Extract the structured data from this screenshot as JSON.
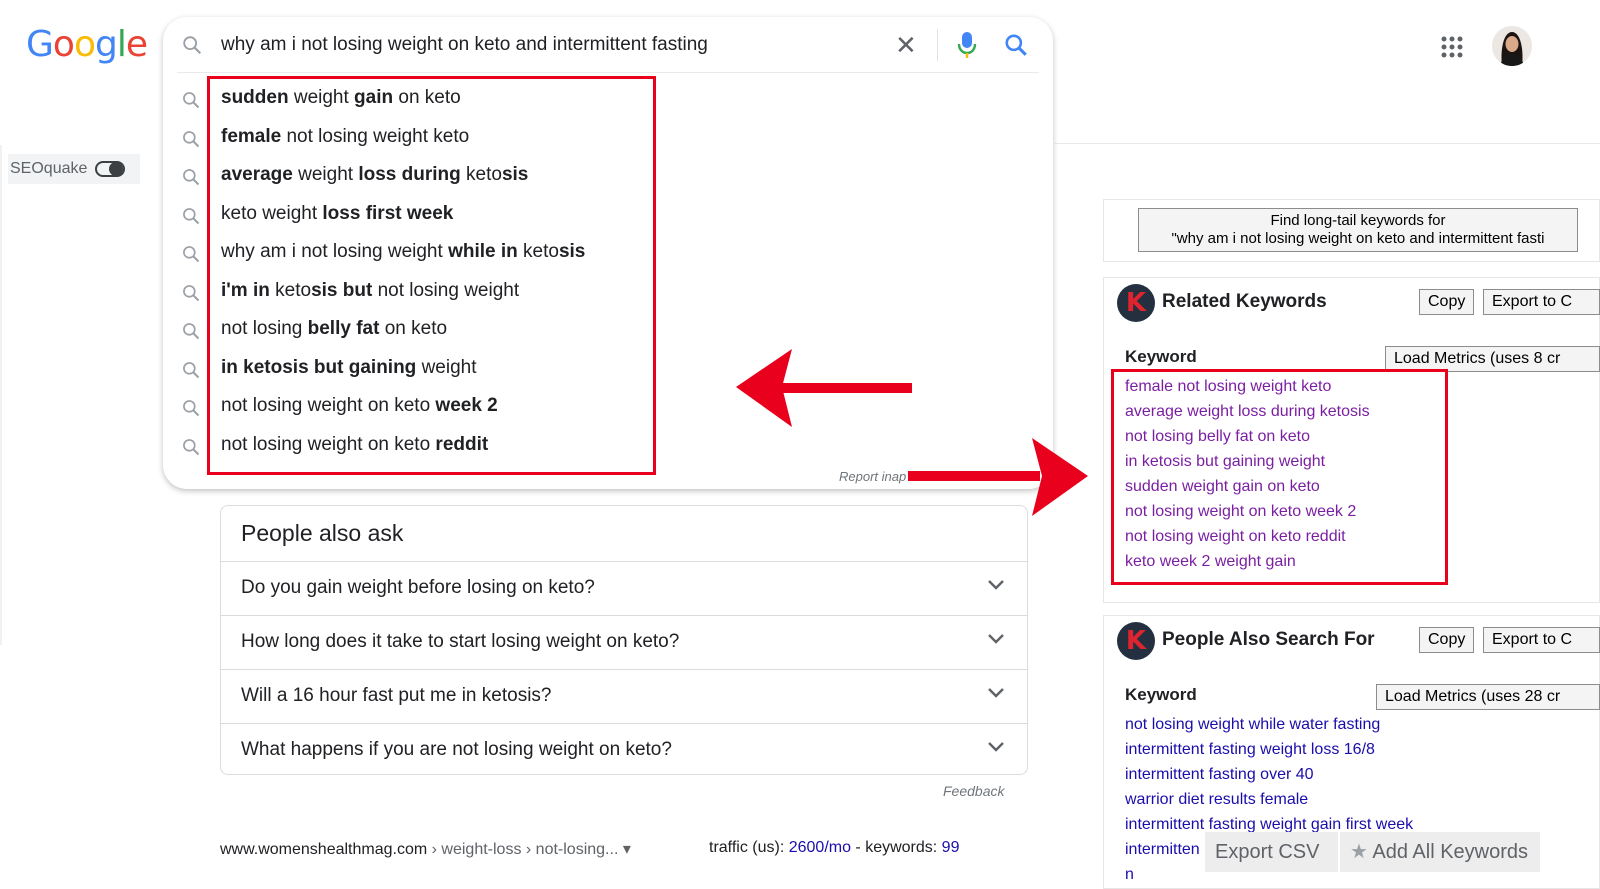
{
  "google": {
    "logo_letters": [
      "G",
      "o",
      "o",
      "g",
      "l",
      "e"
    ],
    "logo_colors": [
      "#4285F4",
      "#EA4335",
      "#FBBC05",
      "#4285F4",
      "#34A853",
      "#EA4335"
    ]
  },
  "search": {
    "query": "why am i not losing weight on keto and intermittent fasting",
    "suggestions": [
      {
        "parts": [
          {
            "t": "sudden",
            "b": true
          },
          {
            "t": " weight ",
            "b": false
          },
          {
            "t": "gain",
            "b": true
          },
          {
            "t": " on keto",
            "b": false
          }
        ]
      },
      {
        "parts": [
          {
            "t": "female",
            "b": true
          },
          {
            "t": " not losing weight keto",
            "b": false
          }
        ]
      },
      {
        "parts": [
          {
            "t": "average",
            "b": true
          },
          {
            "t": " weight ",
            "b": false
          },
          {
            "t": "loss during",
            "b": true
          },
          {
            "t": " keto",
            "b": false
          },
          {
            "t": "sis",
            "b": true
          }
        ]
      },
      {
        "parts": [
          {
            "t": "keto weight ",
            "b": false
          },
          {
            "t": "loss first week",
            "b": true
          }
        ]
      },
      {
        "parts": [
          {
            "t": "why am i not losing weight ",
            "b": false
          },
          {
            "t": "while",
            "b": true
          },
          {
            "t": " ",
            "b": false
          },
          {
            "t": "in",
            "b": true
          },
          {
            "t": " keto",
            "b": false
          },
          {
            "t": "sis",
            "b": true
          }
        ]
      },
      {
        "parts": [
          {
            "t": "i'm in",
            "b": true
          },
          {
            "t": " keto",
            "b": false
          },
          {
            "t": "sis but",
            "b": true
          },
          {
            "t": " not losing weight",
            "b": false
          }
        ]
      },
      {
        "parts": [
          {
            "t": "not losing ",
            "b": false
          },
          {
            "t": "belly fat",
            "b": true
          },
          {
            "t": " on keto",
            "b": false
          }
        ]
      },
      {
        "parts": [
          {
            "t": "in ketosis but gaining",
            "b": true
          },
          {
            "t": " weight",
            "b": false
          }
        ]
      },
      {
        "parts": [
          {
            "t": "not losing weight on keto ",
            "b": false
          },
          {
            "t": "week 2",
            "b": true
          }
        ]
      },
      {
        "parts": [
          {
            "t": "not losing weight on keto ",
            "b": false
          },
          {
            "t": "reddit",
            "b": true
          }
        ]
      }
    ],
    "report_text": "Report inap"
  },
  "seoquake": {
    "label": "SEOquake"
  },
  "people_also_ask": {
    "title": "People also ask",
    "questions": [
      "Do you gain weight before losing on keto?",
      "How long does it take to start losing weight on keto?",
      "Will a 16 hour fast put me in ketosis?",
      "What happens if you are not losing weight on keto?"
    ],
    "feedback": "Feedback"
  },
  "result": {
    "domain": "www.womenshealthmag.com",
    "crumbs": " › weight-loss › not-losing... ▾",
    "traffic_label": "traffic (us): ",
    "traffic_value": "2600/mo",
    "keywords_label": " - keywords: ",
    "keywords_value": "99"
  },
  "longtail": {
    "line1": "Find long-tail keywords for",
    "line2": "\"why am i not losing weight on keto and intermittent fasti"
  },
  "related": {
    "logo": "K",
    "title": "Related Keywords",
    "copy": "Copy",
    "export": "Export to C",
    "keyword_head": "Keyword",
    "load_metrics": "Load Metrics (uses 8 cr",
    "keywords": [
      "female not losing weight keto",
      "average weight loss during ketosis",
      "not losing belly fat on keto",
      "in ketosis but gaining weight",
      "sudden weight gain on keto",
      "not losing weight on keto week 2",
      "not losing weight on keto reddit",
      "keto week 2 weight gain"
    ]
  },
  "also_search": {
    "logo": "K",
    "title": "People Also Search For",
    "copy": "Copy",
    "export": "Export to C",
    "keyword_head": "Keyword",
    "load_metrics": "Load Metrics (uses 28 cr",
    "keywords": [
      "not losing weight while water fasting",
      "intermittent fasting weight loss 16/8",
      "intermittent fasting over 40",
      "warrior diet results female",
      "intermittent fasting weight gain first week",
      "intermitten",
      "n"
    ]
  },
  "floating": {
    "export_csv": "Export CSV",
    "add_all": "Add All Keywords"
  },
  "colors": {
    "annotation_red": "#e8001c",
    "link_visited": "#7b1fa2",
    "link": "#1a0dab"
  }
}
